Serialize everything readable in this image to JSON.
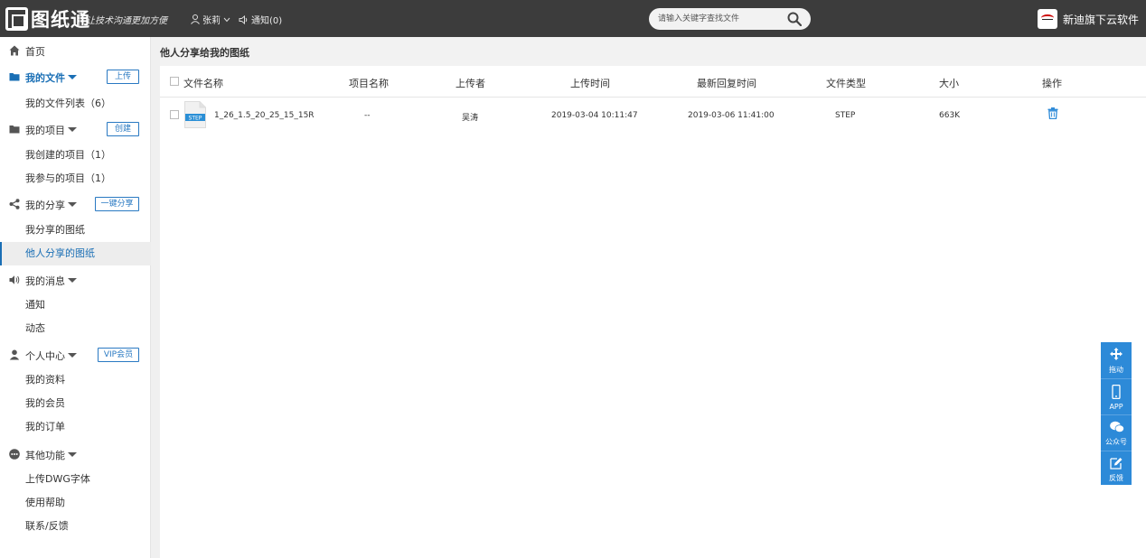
{
  "header": {
    "logo_text": "图纸通",
    "slogan": "让技术沟通更加方便",
    "user_name": "张莉",
    "notice_label": "通知(0)",
    "search_placeholder": "请输入关键字查找文件",
    "brand": "新迪旗下云软件",
    "colors": {
      "bar": "#3c3c3c",
      "accent": "#1a6fb5"
    }
  },
  "sidebar": {
    "home": "首页",
    "my_files": {
      "label": "我的文件",
      "action": "上传",
      "items": [
        "我的文件列表（6）"
      ]
    },
    "my_projects": {
      "label": "我的项目",
      "action": "创建",
      "items": [
        "我创建的项目（1）",
        "我参与的项目（1）"
      ]
    },
    "my_share": {
      "label": "我的分享",
      "action": "一键分享",
      "items": [
        "我分享的图纸",
        "他人分享的图纸"
      ]
    },
    "my_messages": {
      "label": "我的消息",
      "items": [
        "通知",
        "动态"
      ]
    },
    "personal": {
      "label": "个人中心",
      "action": "VIP会员",
      "items": [
        "我的资料",
        "我的会员",
        "我的订单"
      ]
    },
    "other": {
      "label": "其他功能",
      "items": [
        "上传DWG字体",
        "使用帮助",
        "联系/反馈"
      ]
    }
  },
  "main": {
    "title": "他人分享给我的图纸",
    "columns": [
      "文件名称",
      "项目名称",
      "上传者",
      "上传时间",
      "最新回复时间",
      "文件类型",
      "大小",
      "操作"
    ],
    "rows": [
      {
        "file_badge": "STEP",
        "name": "1_26_1.5_20_25_15_15R",
        "project": "--",
        "uploader": "吴涛",
        "upload_time": "2019-03-04 10:11:47",
        "reply_time": "2019-03-06 11:41:00",
        "type": "STEP",
        "size": "663K"
      }
    ]
  },
  "float_tools": [
    "拖动",
    "APP",
    "公众号",
    "反馈"
  ]
}
